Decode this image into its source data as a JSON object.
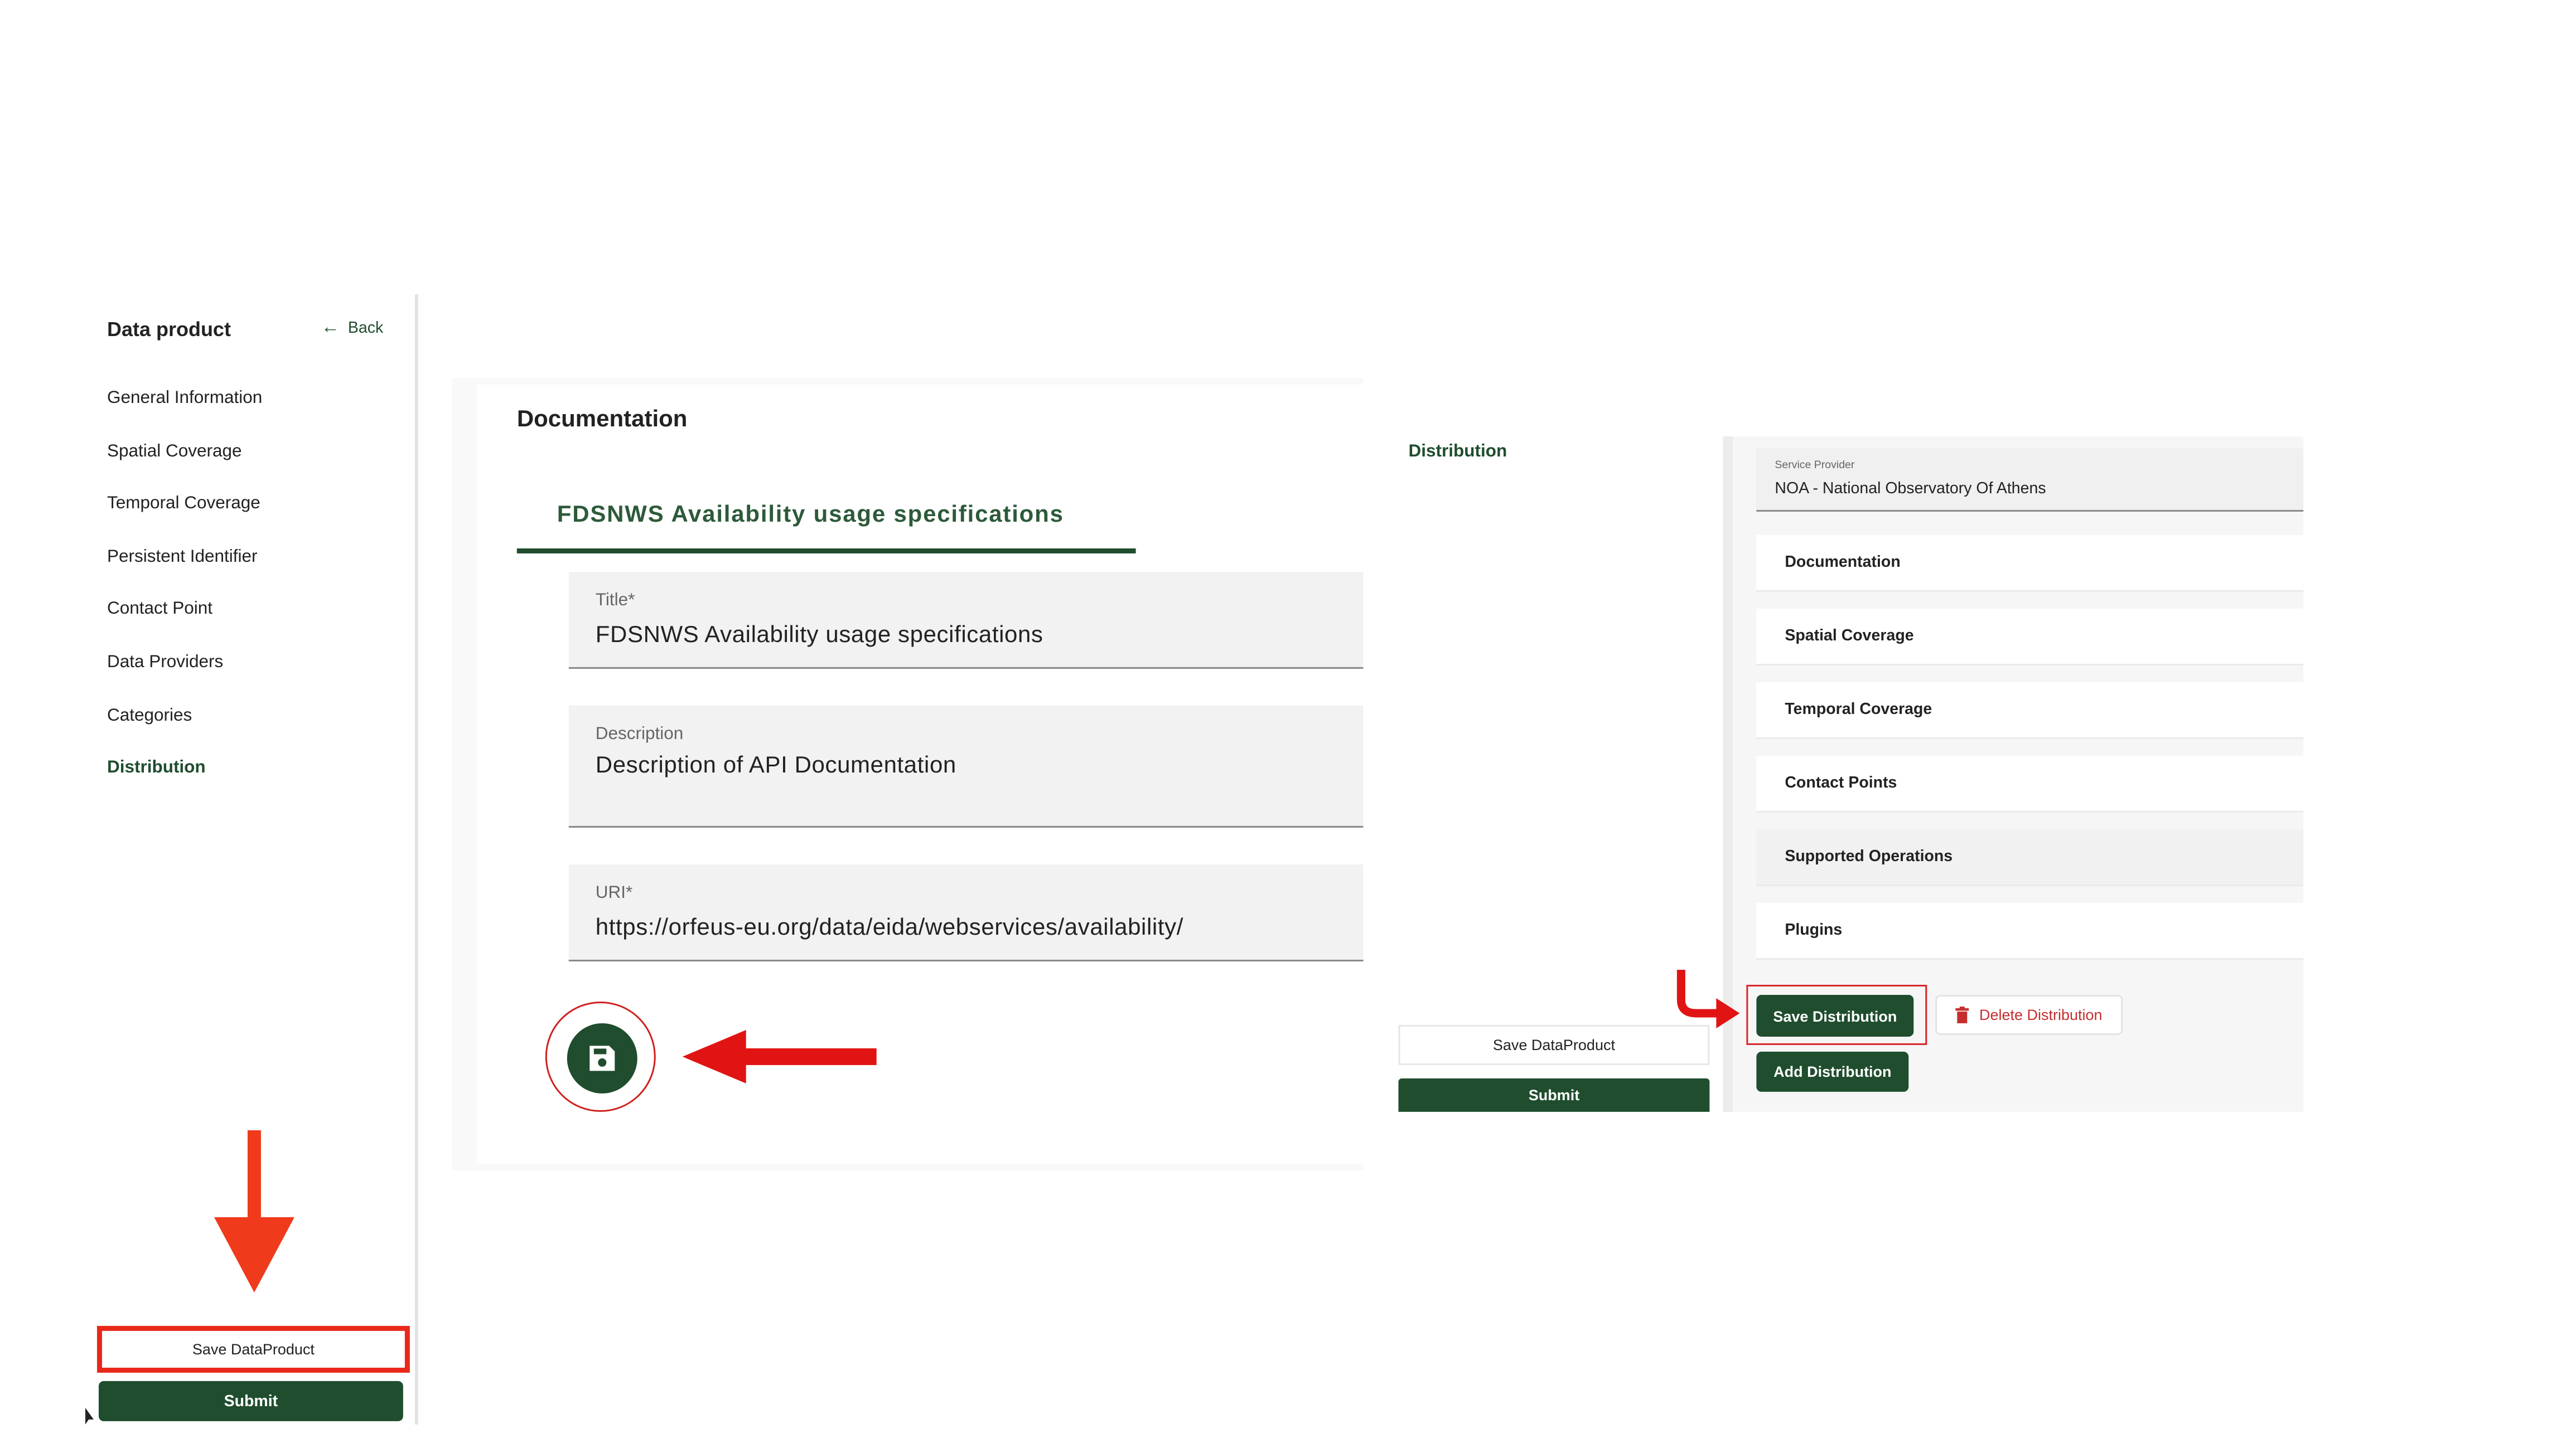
{
  "sidebar": {
    "title": "Data product",
    "back_label": "Back",
    "items": [
      {
        "label": "General Information"
      },
      {
        "label": "Spatial Coverage"
      },
      {
        "label": "Temporal Coverage"
      },
      {
        "label": "Persistent Identifier"
      },
      {
        "label": "Contact Point"
      },
      {
        "label": "Data Providers"
      },
      {
        "label": "Categories"
      },
      {
        "label": "Distribution",
        "active": true
      }
    ],
    "save_label": "Save DataProduct",
    "submit_label": "Submit"
  },
  "documentation": {
    "heading": "Documentation",
    "tab_label": "FDSNWS Availability usage specifications",
    "fields": {
      "title": {
        "label": "Title*",
        "value": "FDSNWS Availability usage specifications"
      },
      "description": {
        "label": "Description",
        "value": "Description of API Documentation"
      },
      "uri": {
        "label": "URI*",
        "value": "https://orfeus-eu.org/data/eida/webservices/availability/"
      }
    },
    "save_icon": "floppy-disk-icon"
  },
  "distribution": {
    "title": "Distribution",
    "service_provider": {
      "label": "Service Provider",
      "value": "NOA - National Observatory Of Athens"
    },
    "sections": [
      {
        "label": "Documentation"
      },
      {
        "label": "Spatial Coverage"
      },
      {
        "label": "Temporal Coverage"
      },
      {
        "label": "Contact Points"
      },
      {
        "label": "Supported Operations"
      },
      {
        "label": "Plugins"
      }
    ],
    "save_distribution_label": "Save Distribution",
    "delete_distribution_label": "Delete Distribution",
    "add_distribution_label": "Add Distribution",
    "save_dataproduct_label": "Save DataProduct",
    "submit_label": "Submit"
  },
  "colors": {
    "primary_green": "#1f4d2e",
    "highlight_red": "#e8281a",
    "delete_red": "#c62e2e"
  }
}
